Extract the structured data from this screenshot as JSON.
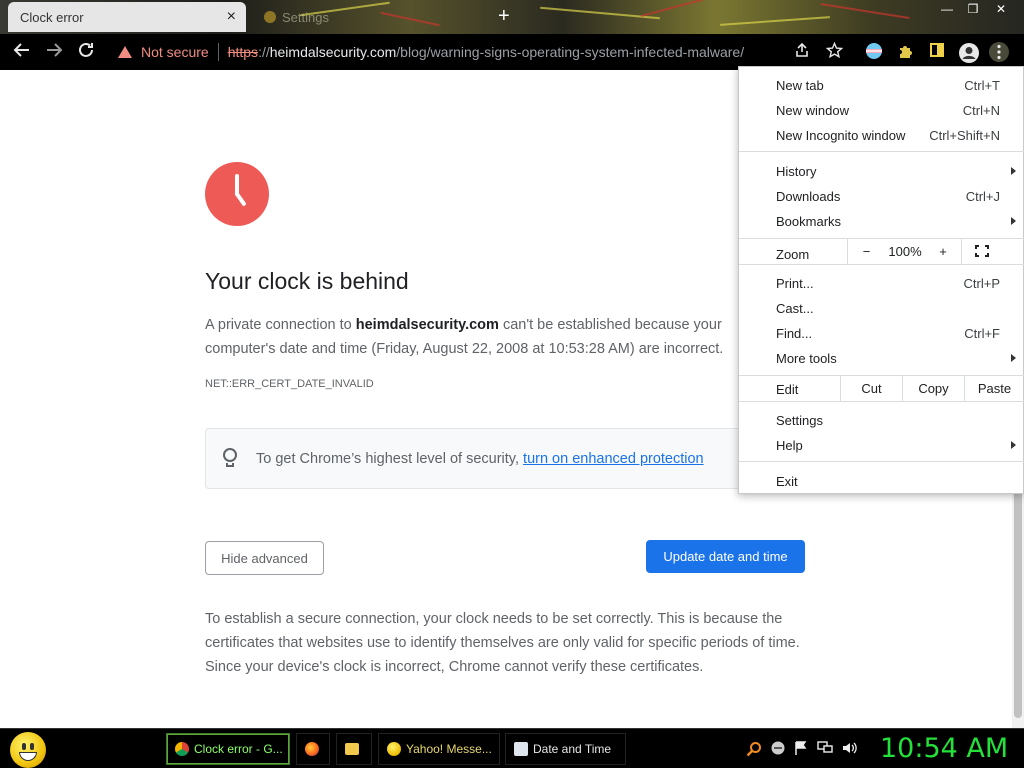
{
  "browser": {
    "active_tab_title": "Clock error",
    "tab_close": "×",
    "second_tab_title": "Settings",
    "new_tab": "+",
    "win_controls": [
      "—",
      "❐",
      "✕"
    ],
    "security_label": "Not secure",
    "url_scheme": "https",
    "url_sep": "://",
    "url_domain": "heimdalsecurity.com",
    "url_path": "/blog/warning-signs-operating-system-infected-malware/"
  },
  "page": {
    "title": "Your clock is behind",
    "desc_prefix": "A private connection to ",
    "desc_domain": "heimdalsecurity.com",
    "desc_suffix": " can't be established because your computer's date and time (Friday, August 22, 2008 at 10:53:28 AM) are incorrect.",
    "error_code": "NET::ERR_CERT_DATE_INVALID",
    "enhanced_prefix": "To get Chrome’s highest level of security, ",
    "enhanced_link": "turn on enhanced protection",
    "hide_advanced": "Hide advanced",
    "update_button": "Update date and time",
    "explanation": "To establish a secure connection, your clock needs to be set correctly. This is because the certificates that websites use to identify themselves are only valid for specific periods of time. Since your device's clock is incorrect, Chrome cannot verify these certificates."
  },
  "menu": {
    "new_tab": "New tab",
    "new_tab_sc": "Ctrl+T",
    "new_window": "New window",
    "new_window_sc": "Ctrl+N",
    "incognito": "New Incognito window",
    "incognito_sc": "Ctrl+Shift+N",
    "history": "History",
    "downloads": "Downloads",
    "downloads_sc": "Ctrl+J",
    "bookmarks": "Bookmarks",
    "zoom": "Zoom",
    "zoom_minus": "−",
    "zoom_value": "100%",
    "zoom_plus": "+",
    "print": "Print...",
    "print_sc": "Ctrl+P",
    "cast": "Cast...",
    "find": "Find...",
    "find_sc": "Ctrl+F",
    "more_tools": "More tools",
    "edit": "Edit",
    "cut": "Cut",
    "copy": "Copy",
    "paste": "Paste",
    "settings": "Settings",
    "help": "Help",
    "exit": "Exit"
  },
  "taskbar": {
    "chrome_task": "Clock error - G...",
    "yahoo_task": "Yahoo! Messe...",
    "date_task": "Date and Time",
    "clock": "10:54 AM"
  },
  "colors": {
    "accent_blue": "#1a73e8",
    "warning_red": "#f28b82",
    "clock_icon": "#ee5b56",
    "taskbar_clock": "#24e13a"
  },
  "icons": [
    "back-icon",
    "forward-icon",
    "reload-icon",
    "warning-icon",
    "share-icon",
    "star-icon",
    "extension-icon",
    "profile-icon",
    "kebab-menu-icon",
    "clock-icon",
    "lightbulb-icon",
    "fullscreen-icon"
  ]
}
